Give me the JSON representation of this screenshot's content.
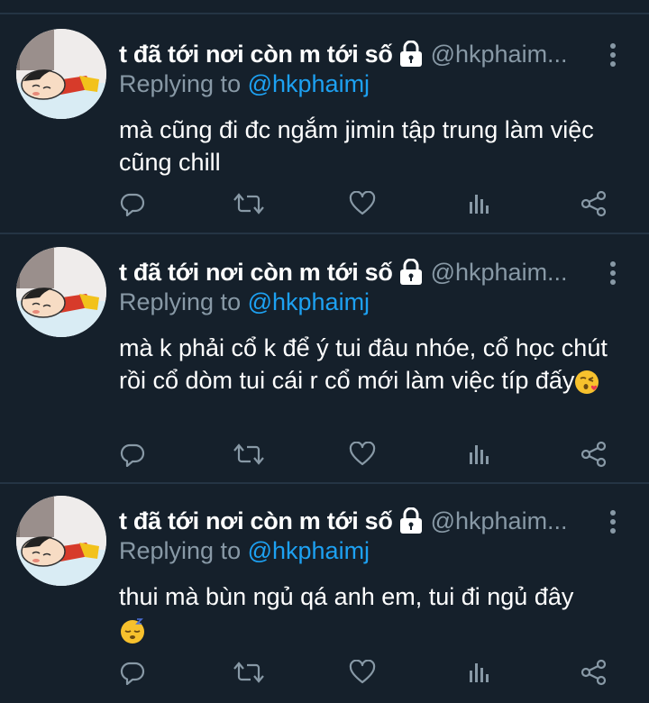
{
  "colors": {
    "background": "#15202b",
    "divider": "#243444",
    "text_primary": "#ffffff",
    "text_secondary": "#8899a6",
    "link": "#1da1f2",
    "icon": "#8899a6"
  },
  "tweets": [
    {
      "display_name": "t đã tới nơi còn m tới số",
      "handle": "@hkphaim...",
      "reply_prefix": "Replying to",
      "reply_handle": "@hkphaimj",
      "text": "mà cũng đi đc ngắm jimin tập trung làm việc cũng chill",
      "text_emoji": ""
    },
    {
      "display_name": "t đã tới nơi còn m tới số",
      "handle": "@hkphaim...",
      "reply_prefix": "Replying to",
      "reply_handle": "@hkphaimj",
      "text": "mà k phải cổ k để ý tui đâu nhóe, cổ học chút rồi cổ dòm tui cái r cổ mới làm việc típ đấy",
      "text_emoji": "face-blowing-kiss"
    },
    {
      "display_name": "t đã tới nơi còn m tới số",
      "handle": "@hkphaim...",
      "reply_prefix": "Replying to",
      "reply_handle": "@hkphaimj",
      "text": "thui mà bùn ngủ qá anh em, tui đi ngủ đây",
      "text_emoji": "sleepy-face"
    }
  ],
  "icons": {
    "lock": "lock-icon",
    "more": "more-vertical-icon",
    "reply": "reply-icon",
    "retweet": "retweet-icon",
    "like": "heart-icon",
    "analytics": "analytics-icon",
    "share": "share-icon"
  }
}
